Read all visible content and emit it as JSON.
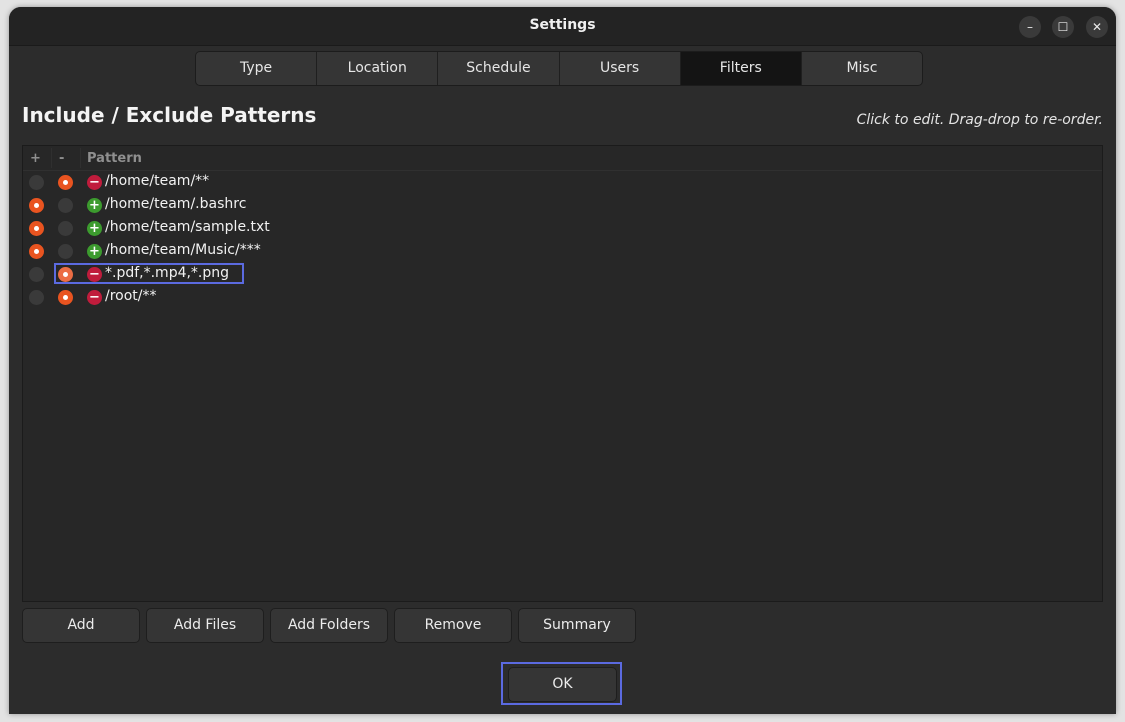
{
  "window": {
    "title": "Settings",
    "controls": {
      "minimize": "–",
      "maximize": "☐",
      "close": "✕"
    }
  },
  "tabs": [
    {
      "label": "Type",
      "active": false
    },
    {
      "label": "Location",
      "active": false
    },
    {
      "label": "Schedule",
      "active": false
    },
    {
      "label": "Users",
      "active": false
    },
    {
      "label": "Filters",
      "active": true
    },
    {
      "label": "Misc",
      "active": false
    }
  ],
  "section": {
    "heading": "Include / Exclude Patterns",
    "hint": "Click to edit. Drag-drop to re-order."
  },
  "list": {
    "columns": {
      "include": "+",
      "exclude": "-",
      "pattern": "Pattern"
    },
    "rows": [
      {
        "include": false,
        "exclude": true,
        "type": "exclude",
        "badge": "−",
        "pattern": "/home/team/**"
      },
      {
        "include": true,
        "exclude": false,
        "type": "include",
        "badge": "+",
        "pattern": "/home/team/.bashrc"
      },
      {
        "include": true,
        "exclude": false,
        "type": "include",
        "badge": "+",
        "pattern": "/home/team/sample.txt"
      },
      {
        "include": true,
        "exclude": false,
        "type": "include",
        "badge": "+",
        "pattern": "/home/team/Music/***"
      },
      {
        "include": false,
        "exclude": true,
        "type": "exclude",
        "badge": "−",
        "pattern": "*.pdf,*.mp4,*.png",
        "focused": true
      },
      {
        "include": false,
        "exclude": true,
        "type": "exclude",
        "badge": "−",
        "pattern": "/root/**"
      }
    ]
  },
  "buttons": {
    "add": "Add",
    "add_files": "Add Files",
    "add_folders": "Add Folders",
    "remove": "Remove",
    "summary": "Summary",
    "ok": "OK"
  },
  "colors": {
    "accent": "#e95420",
    "include": "#3c9b2e",
    "exclude": "#c01c3c",
    "focus": "#5b6ae0"
  }
}
